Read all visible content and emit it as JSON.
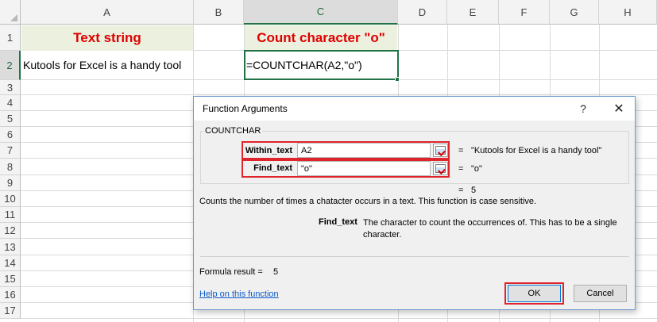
{
  "sheet": {
    "columns": [
      "A",
      "B",
      "C",
      "D",
      "E",
      "F",
      "G",
      "H"
    ],
    "rows": [
      "1",
      "2",
      "3",
      "4",
      "5",
      "6",
      "7",
      "8",
      "9",
      "10",
      "11",
      "12",
      "13",
      "14",
      "15",
      "16",
      "17"
    ],
    "a1": "Text string",
    "c1": "Count character \"o\"",
    "a2": "Kutools for Excel is a handy tool",
    "c2": "=COUNTCHAR(A2,\"o\")",
    "header_fill": "#ebf1de",
    "header_text_color": "#e00000",
    "selection_color": "#217346"
  },
  "dialog": {
    "title": "Function Arguments",
    "help_icon": "?",
    "close_icon": "✕",
    "function_name": "COUNTCHAR",
    "args": [
      {
        "label": "Within_text",
        "value": "A2",
        "result": "\"Kutools for Excel is a handy tool\""
      },
      {
        "label": "Find_text",
        "value": "\"o\"",
        "result": "\"o\""
      }
    ],
    "equals": "=",
    "overall_result": "5",
    "description": "Counts the number of times a chatacter occurs in a text. This function is case sensitive.",
    "param_name": "Find_text",
    "param_description": "The character to count the occurrences of. This has to be a single character.",
    "formula_result_label": "Formula result =",
    "formula_result_value": "5",
    "help_link": "Help on this function",
    "ok_label": "OK",
    "cancel_label": "Cancel",
    "highlight_color": "#e0242b"
  }
}
